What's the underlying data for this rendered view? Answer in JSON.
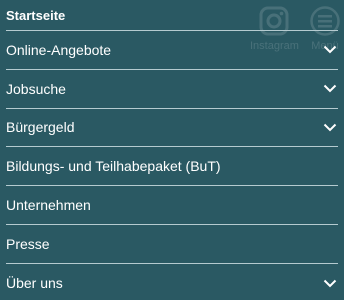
{
  "background_color": "#2a5963",
  "divider_color": "#b5cbd0",
  "background_icons": {
    "instagram": {
      "icon": "instagram-icon",
      "label": "Instagram"
    },
    "menu": {
      "icon": "menu-icon",
      "label": "Menü"
    }
  },
  "nav": {
    "items": [
      {
        "label": "Startseite",
        "expandable": false
      },
      {
        "label": "Online-Angebote",
        "expandable": true,
        "icon": "chevron-down-icon"
      },
      {
        "label": "Jobsuche",
        "expandable": true,
        "icon": "chevron-down-icon"
      },
      {
        "label": "Bürgergeld",
        "expandable": true,
        "icon": "chevron-down-icon"
      },
      {
        "label": "Bildungs- und Teilhabepaket (BuT)",
        "expandable": false
      },
      {
        "label": "Unternehmen",
        "expandable": false
      },
      {
        "label": "Presse",
        "expandable": false
      },
      {
        "label": "Über uns",
        "expandable": true,
        "icon": "chevron-down-icon"
      }
    ]
  }
}
